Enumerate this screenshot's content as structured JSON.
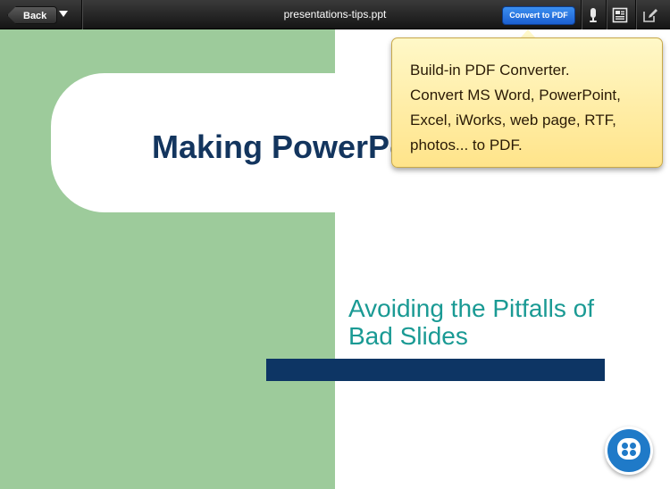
{
  "toolbar": {
    "back_label": "Back",
    "document_title": "presentations-tips.ppt",
    "convert_label": "Convert to PDF",
    "icons": [
      "menu-arrow-icon",
      "microphone-icon",
      "document-view-icon",
      "edit-icon"
    ]
  },
  "slide": {
    "title": "Making PowerPoint Slides",
    "subtitle_lines": [
      "Avoiding the Pitfalls of",
      "Bad Slides"
    ],
    "colors": {
      "green": "#9dcb9b",
      "title": "#13355e",
      "subtitle": "#1a9a94",
      "bar": "#0d3564"
    }
  },
  "tooltip": {
    "lines": [
      "Build-in PDF Converter.",
      "Convert MS Word, PowerPoint,",
      "Excel, iWorks, web page, RTF,",
      "photos... to PDF."
    ]
  },
  "chat": {
    "icon": "chat-bubble-icon"
  }
}
